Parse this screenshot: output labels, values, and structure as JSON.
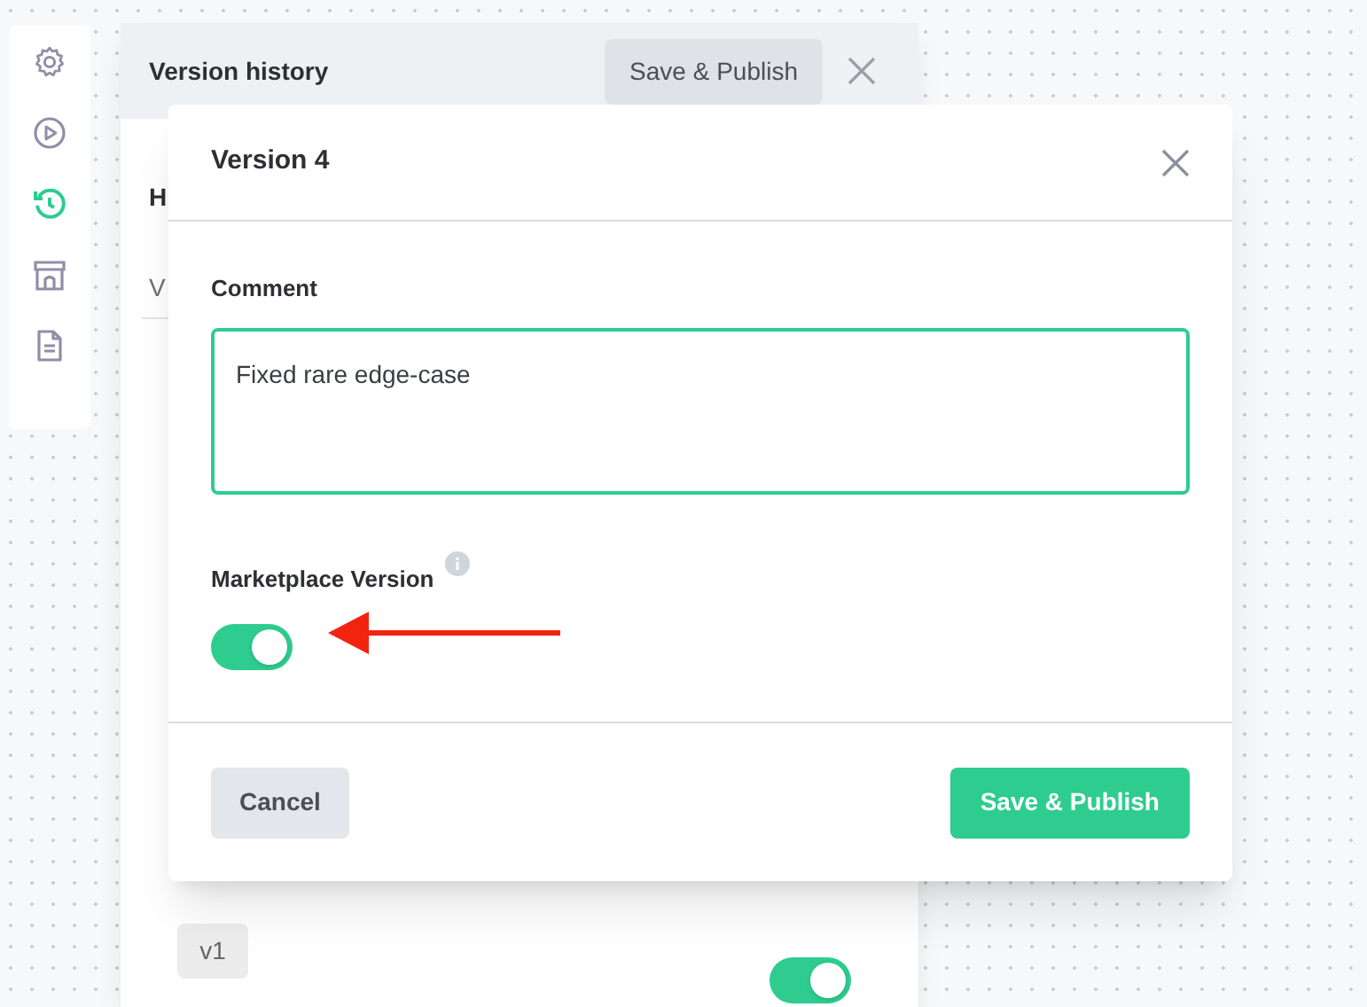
{
  "sidebar": {
    "items": [
      {
        "selected": false
      },
      {
        "selected": false
      },
      {
        "selected": true
      },
      {
        "selected": false
      },
      {
        "selected": false
      }
    ]
  },
  "version_history_panel": {
    "title": "Version history",
    "publish_button": "Save & Publish",
    "section_heading": "H",
    "section_label": "V",
    "version_badge": "v1",
    "version_toggle_on": true
  },
  "modal": {
    "title": "Version 4",
    "comment_label": "Comment",
    "comment_value": "Fixed rare edge-case",
    "marketplace_label": "Marketplace Version",
    "marketplace_on": true,
    "cancel_button": "Cancel",
    "save_button": "Save & Publish"
  }
}
